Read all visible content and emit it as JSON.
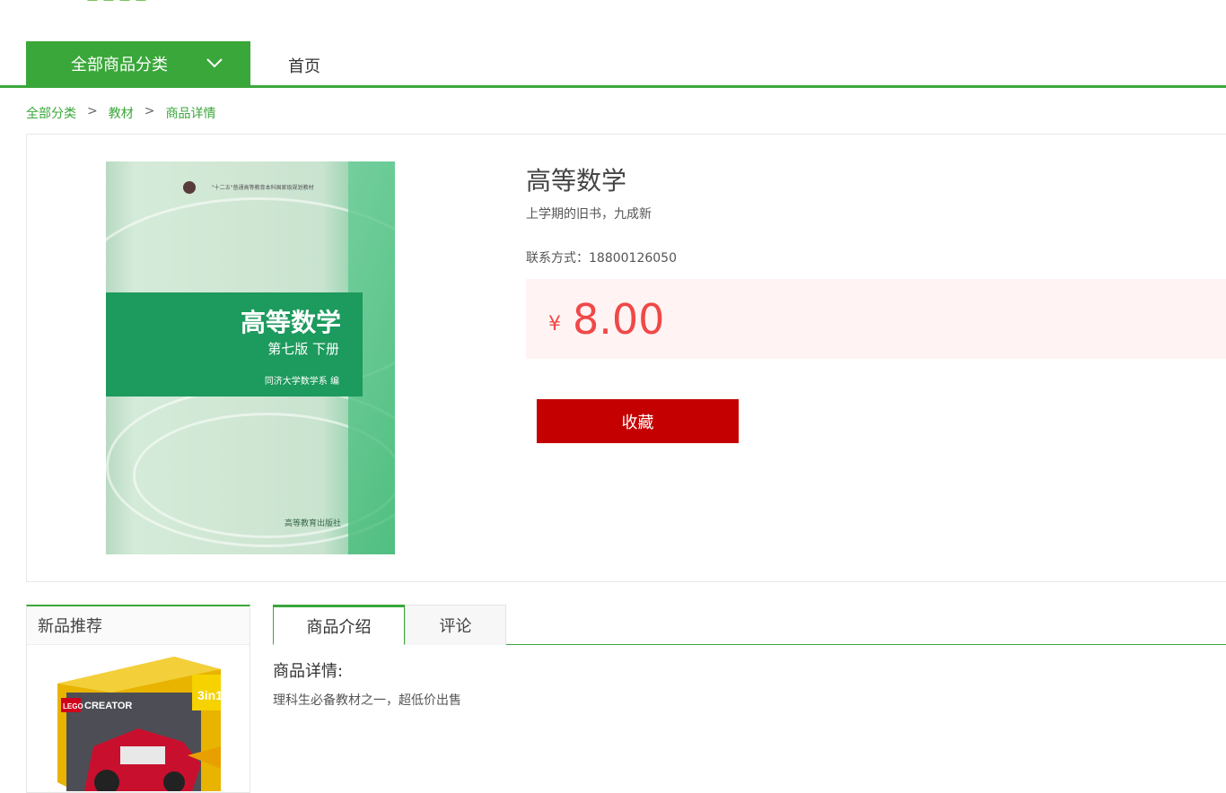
{
  "nav": {
    "category_label": "全部商品分类",
    "home_label": "首页"
  },
  "breadcrumb": {
    "items": [
      "全部分类",
      "教材",
      "商品详情"
    ],
    "separator": ">"
  },
  "product": {
    "title": "高等数学",
    "subtitle": "上学期的旧书，九成新",
    "contact": "联系方式：18800126050",
    "currency": "¥",
    "price": "8.00",
    "favorite_label": "收藏",
    "cover": {
      "title": "高等数学",
      "edition": "第七版  下册",
      "author": "同济大学数学系  编",
      "series": "\"十二五\"普通高等教育本科国家级规划教材",
      "publisher": "高等教育出版社"
    }
  },
  "sidebar": {
    "heading": "新品推荐",
    "lego_brand": "LEGO",
    "lego_line": "CREATOR",
    "lego_badge": "3in1"
  },
  "tabs": {
    "items": [
      "商品介绍",
      "评论"
    ],
    "active": 0
  },
  "details": {
    "heading": "商品详情:",
    "body": "理科生必备教材之一，超低价出售"
  },
  "colors": {
    "brand_green": "#3aa73a",
    "price_red": "#f04848",
    "favorite_red": "#c40000",
    "price_bg": "#fff3f3"
  }
}
